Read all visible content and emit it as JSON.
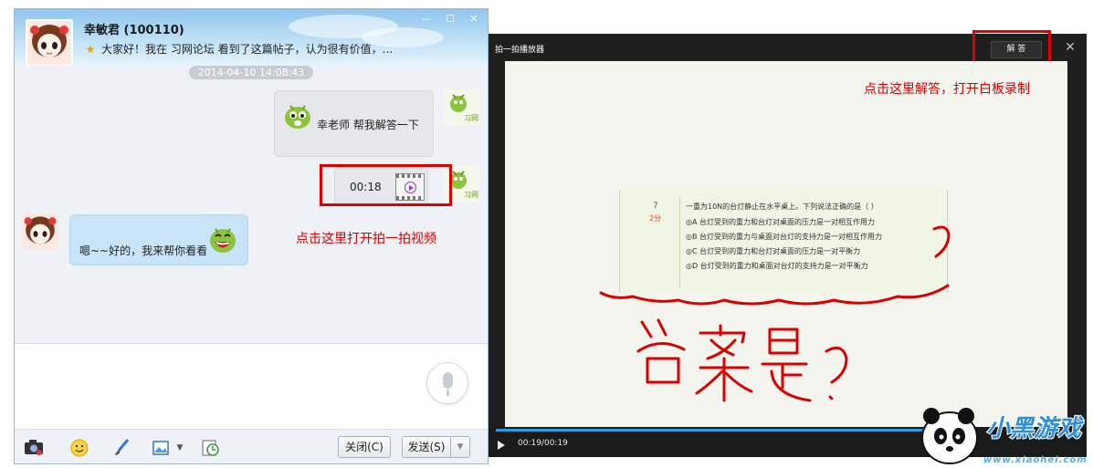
{
  "chat": {
    "contact_name": "幸敏君 (100110)",
    "signature": "大家好！我在 习网论坛 看到了这篇帖子，认为很有价值，...",
    "timestamp": "2014-04-10 14:08:43",
    "messages": {
      "request": "幸老师 帮我解答一下",
      "voice_duration": "00:18",
      "reply": "嗯~~好的，我来帮你看看"
    },
    "avatar_tag": "习网",
    "annotation_video": "点击这里打开拍一拍视频",
    "buttons": {
      "close": "关闭(C)",
      "send": "发送(S)"
    }
  },
  "player": {
    "title": "拍一拍播放器",
    "answer_button": "解 答",
    "annotation_answer": "点击这里解答，打开白板录制",
    "time": "00:19/00:19",
    "progress": 1.0,
    "quiz": {
      "number": "7",
      "score": "2分",
      "question": "一重为10N的台灯静止在水平桌上。下列说法正确的是（     ）",
      "options": [
        "◎A 台灯受到的重力和台灯对桌面的压力是一对相互作用力",
        "◎B 台灯受到的重力与桌面对台灯的支持力是一对相互作用力",
        "◎C 台灯受到的重力和台灯对桌面的压力是一对平衡力",
        "◎D 台灯受到的重力和桌面对台灯的支持力是一对平衡力"
      ]
    }
  },
  "watermark": {
    "brand": "小黑游戏",
    "url": "www.xiaohei.com"
  },
  "colors": {
    "annotation_red": "#e00000",
    "bubble_blue": "#c9e3f8",
    "progress_blue": "#2b9be0"
  }
}
